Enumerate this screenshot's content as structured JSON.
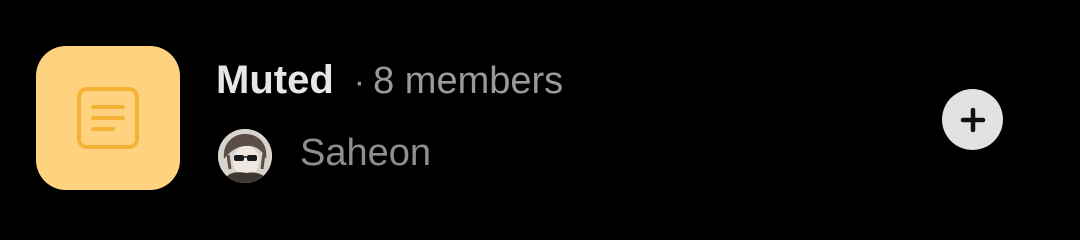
{
  "group": {
    "icon": "document-icon",
    "tile_color": "#FFD27F",
    "name": "Muted",
    "separator": "·",
    "member_count": "8 members"
  },
  "author": {
    "avatar_icon": "user-avatar",
    "name": "Saheon"
  },
  "actions": {
    "add_icon": "plus-icon"
  }
}
